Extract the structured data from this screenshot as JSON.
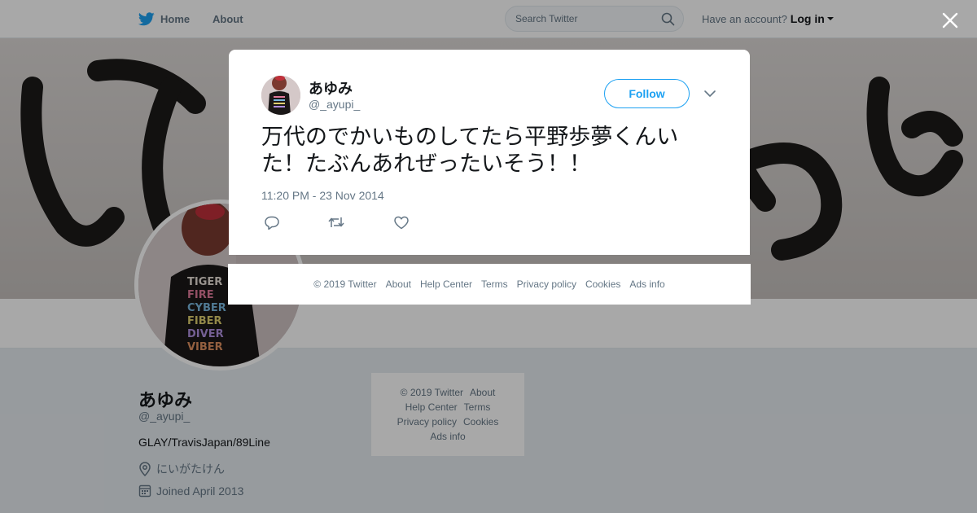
{
  "nav": {
    "home_label": "Home",
    "about_label": "About",
    "search_placeholder": "Search Twitter",
    "have_account": "Have an account?",
    "login_label": "Log in"
  },
  "profile": {
    "name": "あゆみ",
    "handle": "@_ayupi_",
    "bio": "GLAY/TravisJapan/89Line",
    "location": "にいがたけん",
    "joined": "Joined April 2013"
  },
  "side_footer": {
    "copyright": "© 2019 Twitter",
    "about": "About",
    "help_center": "Help Center",
    "terms": "Terms",
    "privacy": "Privacy policy",
    "cookies": "Cookies",
    "ads_info": "Ads info"
  },
  "tweet": {
    "author_name": "あゆみ",
    "author_handle": "@_ayupi_",
    "follow_label": "Follow",
    "text": "万代のでかいものしてたら平野歩夢くんいた！たぶんあれぜったいそう！！",
    "timestamp": "11:20 PM - 23 Nov 2014"
  },
  "modal_footer": {
    "copyright": "© 2019 Twitter",
    "about": "About",
    "help_center": "Help Center",
    "terms": "Terms",
    "privacy": "Privacy policy",
    "cookies": "Cookies",
    "ads_info": "Ads info"
  },
  "colors": {
    "twitter_blue": "#1da1f2",
    "text_primary": "#14171a",
    "text_secondary": "#657786",
    "overlay": "rgba(0,0,0,0.34)"
  },
  "icons": [
    "twitter-bird-icon",
    "search-icon",
    "close-icon",
    "chevron-down-icon",
    "reply-icon",
    "retweet-icon",
    "like-icon",
    "location-pin-icon",
    "calendar-icon"
  ]
}
